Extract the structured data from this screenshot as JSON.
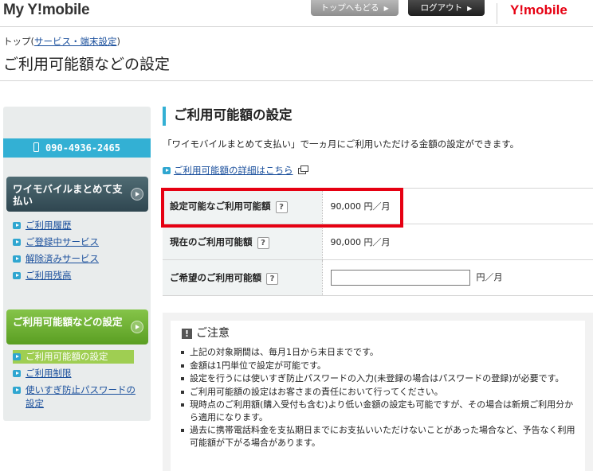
{
  "header": {
    "brand": "My Y!mobile",
    "top_button": "トップへもどる",
    "logout_button": "ログアウト",
    "logo_y": "Y!",
    "logo_rest": "mobile"
  },
  "breadcrumb": {
    "prefix": "トップ(",
    "link": "サービス・端末設定",
    "suffix": ")"
  },
  "page_title": "ご利用可能額などの設定",
  "sidebar": {
    "phone": "090-4936-2465",
    "section1": {
      "title": "ワイモバイルまとめて支払い",
      "items": [
        "ご利用履歴",
        "ご登録中サービス",
        "解除済みサービス",
        "ご利用残高"
      ]
    },
    "section2": {
      "title": "ご利用可能額などの設定",
      "items": [
        "ご利用可能額の設定",
        "ご利用制限",
        "使いすぎ防止パスワードの設定"
      ]
    }
  },
  "main": {
    "section_title": "ご利用可能額の設定",
    "description": "「ワイモバイルまとめて支払い」で一ヵ月にご利用いただける金額の設定ができます。",
    "detail_link": "ご利用可能額の詳細はこちら",
    "rows": [
      {
        "label": "設定可能なご利用可能額",
        "value": "90,000 円／月"
      },
      {
        "label": "現在のご利用可能額",
        "value": "90,000 円／月"
      },
      {
        "label": "ご希望のご利用可能額",
        "input_value": "",
        "unit": "円／月"
      }
    ],
    "help_glyph": "?",
    "caution": {
      "title": "ご注意",
      "warn_glyph": "!",
      "items": [
        "上記の対象期間は、毎月1日から末日までです。",
        "金額は1円単位で設定が可能です。",
        "設定を行うには使いすぎ防止パスワードの入力(未登録の場合はパスワードの登録)が必要です。",
        "ご利用可能額の設定はお客さまの責任において行ってください。",
        "現時点のご利用額(購入受付も含む)より低い金額の設定も可能ですが、その場合は新規ご利用分から適用になります。",
        "過去に携帯電話料金を支払期日までにお支払いいただけないことがあった場合など、予告なく利用可能額が下がる場合があります。"
      ]
    }
  },
  "colors": {
    "accent_blue": "#33b0d4",
    "highlight_red": "#e60012",
    "nav_green": "#7cbf3e",
    "nav_dark": "#3f5a63"
  }
}
